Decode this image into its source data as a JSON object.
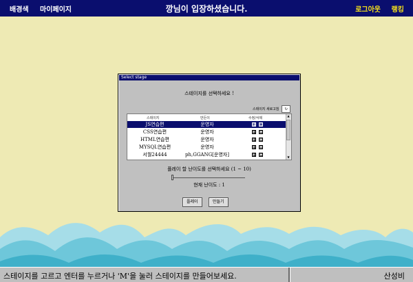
{
  "topbar": {
    "nav1": "배경색",
    "nav2": "마이페이지",
    "welcome": "깡님이 입장하셨습니다.",
    "logout": "로그아웃",
    "ranking": "랭킹"
  },
  "dialog": {
    "title": "Select stage",
    "heading": "스테이지를 선택하세요 !",
    "sort_label": "스테이지 새로고침",
    "sort_value": "↻",
    "columns": [
      "스테이지",
      "만든이",
      "수정/삭제"
    ],
    "rows": [
      {
        "stage": "JS연습편",
        "author": "운영자",
        "selected": true
      },
      {
        "stage": "CSS연습편",
        "author": "운영자",
        "selected": false
      },
      {
        "stage": "HTML연습편",
        "author": "운영자",
        "selected": false
      },
      {
        "stage": "MYSQL연습편",
        "author": "운영자",
        "selected": false
      },
      {
        "stage": "서월24444",
        "author": "ph,GGANG[운영자]",
        "selected": false
      }
    ],
    "edit_icon": "⊞",
    "delete_icon": "⊟",
    "difficulty_prompt": "플레이 할 난이도를 선택하세요 (1 ~ 10)",
    "difficulty": 1,
    "difficulty_min": 1,
    "difficulty_max": 10,
    "current_difficulty": "현재 난이도 : 1",
    "play_label": "플레이",
    "make_label": "만들기"
  },
  "bottombar": {
    "message": "스테이지를 고르고 엔터를 누르거나 'M'을 눌러 스테이지를 만들어보세요.",
    "user": "산성비"
  },
  "colors": {
    "navy": "#0a0e6e",
    "background": "#eeeab4",
    "accent_yellow": "#f7e21b",
    "wave_light": "#a6dde8",
    "wave_mid": "#6ec7da",
    "wave_dark": "#3fb0c9"
  }
}
